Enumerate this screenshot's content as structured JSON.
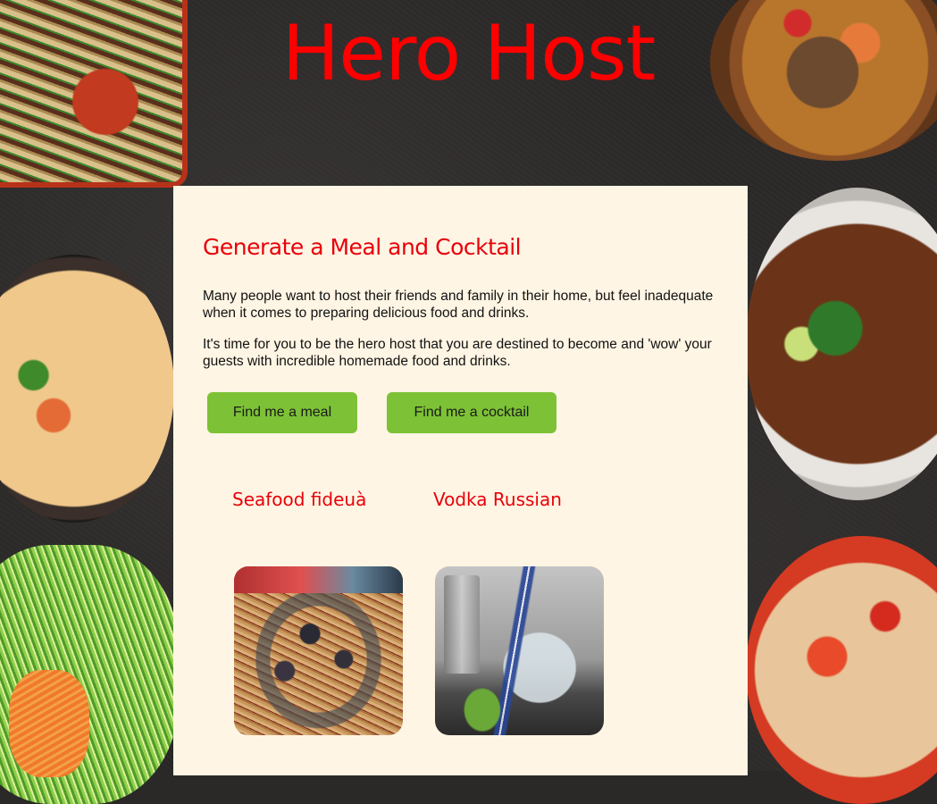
{
  "site": {
    "title": "Hero Host"
  },
  "intro": {
    "heading": "Generate a Meal and Cocktail",
    "paragraph_1": "Many people want to host their friends and family in their home, but feel inadequate when it comes to preparing delicious food and drinks.",
    "paragraph_2": "It's time for you to be the hero host that you are destined to become and 'wow' your guests with incredible homemade food and drinks."
  },
  "buttons": {
    "meal_label": "Find me a meal",
    "cocktail_label": "Find me a cocktail"
  },
  "results": {
    "meal_name": "Seafood fideuà",
    "cocktail_name": "Vodka Russian"
  },
  "colors": {
    "accent_red": "#e8000a",
    "title_red": "#ff0000",
    "button_green": "#7dc236",
    "panel_background": "#fff5e4",
    "page_background": "#2a2727"
  }
}
